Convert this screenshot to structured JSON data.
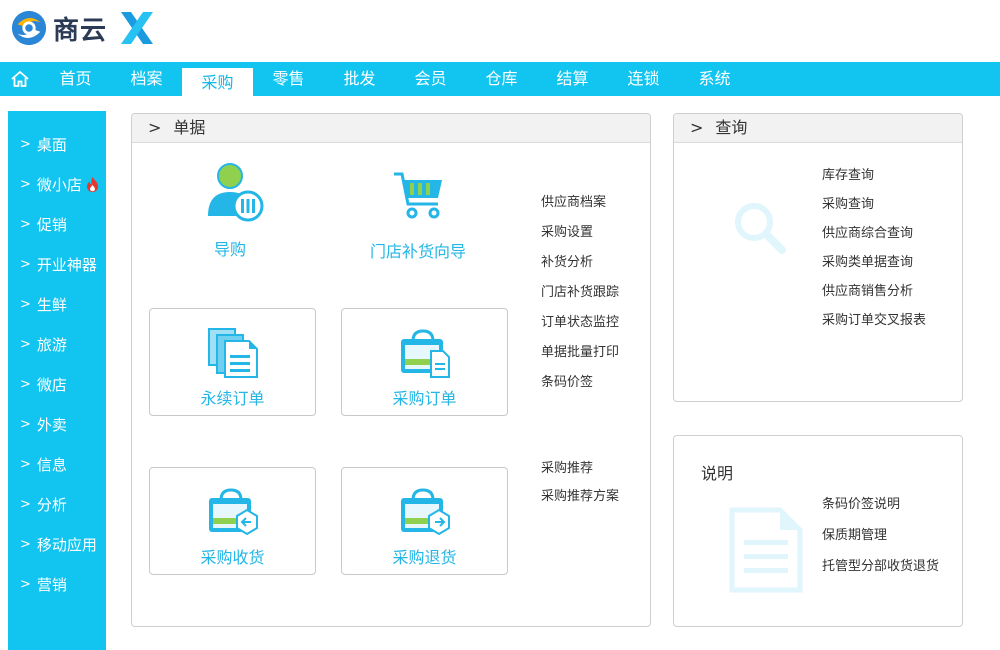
{
  "brand": {
    "name": "商云"
  },
  "navbar": {
    "items": [
      {
        "label": "首页"
      },
      {
        "label": "档案"
      },
      {
        "label": "采购",
        "active": true
      },
      {
        "label": "零售"
      },
      {
        "label": "批发"
      },
      {
        "label": "会员"
      },
      {
        "label": "仓库"
      },
      {
        "label": "结算"
      },
      {
        "label": "连锁"
      },
      {
        "label": "系统"
      }
    ]
  },
  "sidebar": {
    "items": [
      {
        "label": "桌面"
      },
      {
        "label": "微小店"
      },
      {
        "label": "促销"
      },
      {
        "label": "开业神器"
      },
      {
        "label": "生鲜"
      },
      {
        "label": "旅游"
      },
      {
        "label": "微店"
      },
      {
        "label": "外卖"
      },
      {
        "label": "信息"
      },
      {
        "label": "分析"
      },
      {
        "label": "移动应用"
      },
      {
        "label": "营销"
      }
    ]
  },
  "documents": {
    "title": "单据",
    "guide": "导购",
    "replenish_wizard": "门店补货向导",
    "cards": {
      "standing_order": "永续订单",
      "purchase_order": "采购订单",
      "purchase_receive": "采购收货",
      "purchase_return": "采购退货"
    },
    "links_a": [
      "供应商档案",
      "采购设置",
      "补货分析",
      "门店补货跟踪",
      "订单状态监控",
      "单据批量打印",
      "条码价签"
    ],
    "links_b": [
      "采购推荐",
      "采购推荐方案"
    ]
  },
  "query": {
    "title": "查询",
    "links": [
      "库存查询",
      "采购查询",
      "供应商综合查询",
      "采购类单据查询",
      "供应商销售分析",
      "采购订单交叉报表"
    ]
  },
  "notes": {
    "title": "说明",
    "links": [
      "条码价签说明",
      "保质期管理",
      "托管型分部收货退货"
    ]
  },
  "colors": {
    "accent": "#12c4f0",
    "icon": "#23b6e6",
    "fire": "#e8352e"
  }
}
